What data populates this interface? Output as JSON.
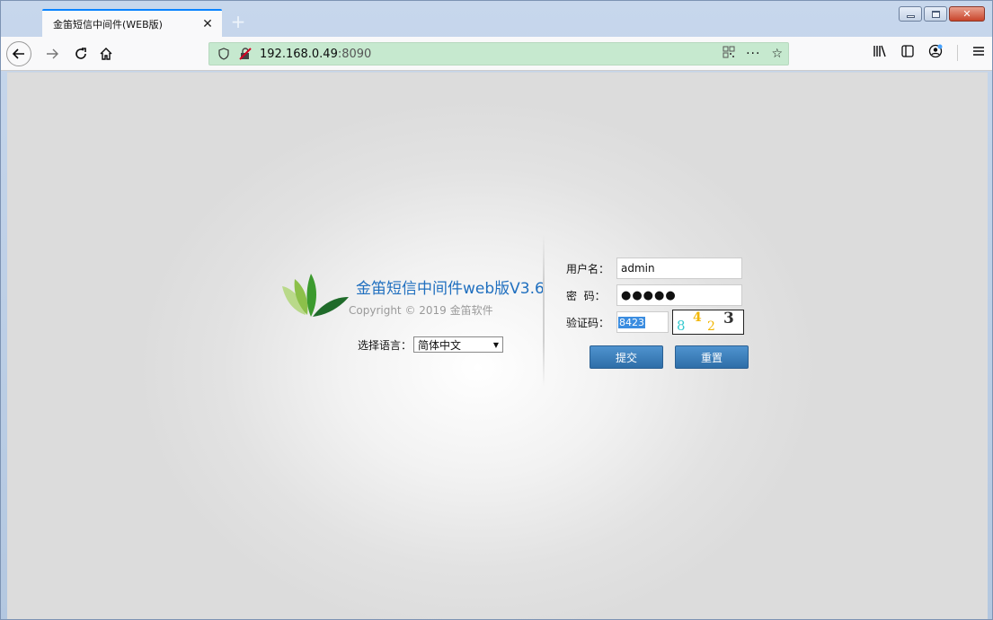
{
  "browser": {
    "tab_title": "金笛短信中间件(WEB版)",
    "url_host": "192.168.0.49",
    "url_port": ":8090"
  },
  "app": {
    "title": "金笛短信中间件web版V3.6",
    "copyright": "Copyright © 2019 金笛软件",
    "language_label": "选择语言：",
    "language_selected": "简体中文"
  },
  "form": {
    "username_label": "用户名：",
    "username_value": "admin",
    "password_label": "密  码：",
    "password_value": "●●●●●",
    "captcha_label": "验证码：",
    "captcha_value": "8423",
    "captcha_digits": [
      "8",
      "4",
      "2",
      "3"
    ],
    "submit_label": "提交",
    "reset_label": "重置"
  },
  "colors": {
    "accent_tab": "#0a84ff",
    "url_bar": "#c6e9cf",
    "title_blue": "#1f6fbf",
    "button_blue": "#3a7fc0"
  }
}
